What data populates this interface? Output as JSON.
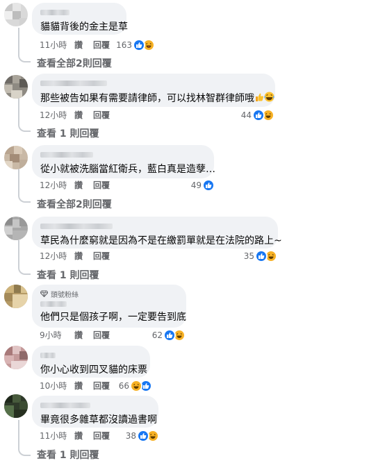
{
  "comments": [
    {
      "text": "貓貓背後的金主是草",
      "time": "11小時",
      "like": "讚",
      "reply": "回覆",
      "count": "163",
      "reactions": [
        "like-icon",
        "haha-icon"
      ]
    },
    {
      "text": "那些被告如果有需要請律師，可以找林智群律師哦",
      "time": "12小時",
      "like": "讚",
      "reply": "回覆",
      "count": "44",
      "reactions": [
        "like-icon",
        "haha-icon"
      ]
    },
    {
      "text": "從小就被洗腦當紅衛兵，藍白真是造孽…",
      "time": "12小時",
      "like": "讚",
      "reply": "回覆",
      "count": "49",
      "reactions": [
        "like-icon"
      ]
    },
    {
      "text": "草民為什麼窮就是因為不是在繳罰單就是在法院的路上~",
      "time": "12小時",
      "like": "讚",
      "reply": "回覆",
      "count": "35",
      "reactions": [
        "like-icon",
        "haha-icon"
      ]
    },
    {
      "badge": "頭號粉絲",
      "text": "他們只是個孩子啊，一定要告到底",
      "time": "9小時",
      "like": "讚",
      "reply": "回覆",
      "count": "62",
      "reactions": [
        "like-icon",
        "haha-icon"
      ]
    },
    {
      "text": "你小心收到四叉貓的床票",
      "time": "10小時",
      "like": "讚",
      "reply": "回覆",
      "count": "66",
      "reactions": [
        "haha-icon",
        "like-icon"
      ]
    },
    {
      "text": "畢竟很多雜草都沒讀過書啊",
      "time": "11小時",
      "like": "讚",
      "reply": "回覆",
      "count": "38",
      "reactions": [
        "like-icon",
        "haha-icon"
      ]
    }
  ],
  "view_replies": [
    "查看全部2則回覆",
    "查看 1 則回覆",
    "查看全部2則回覆",
    "查看 1 則回覆",
    "查看 1 則回覆"
  ],
  "colors": {
    "like": "#1877f2",
    "haha": "#f7b125",
    "bubble": "#f0f2f5",
    "meta": "#65676b"
  }
}
